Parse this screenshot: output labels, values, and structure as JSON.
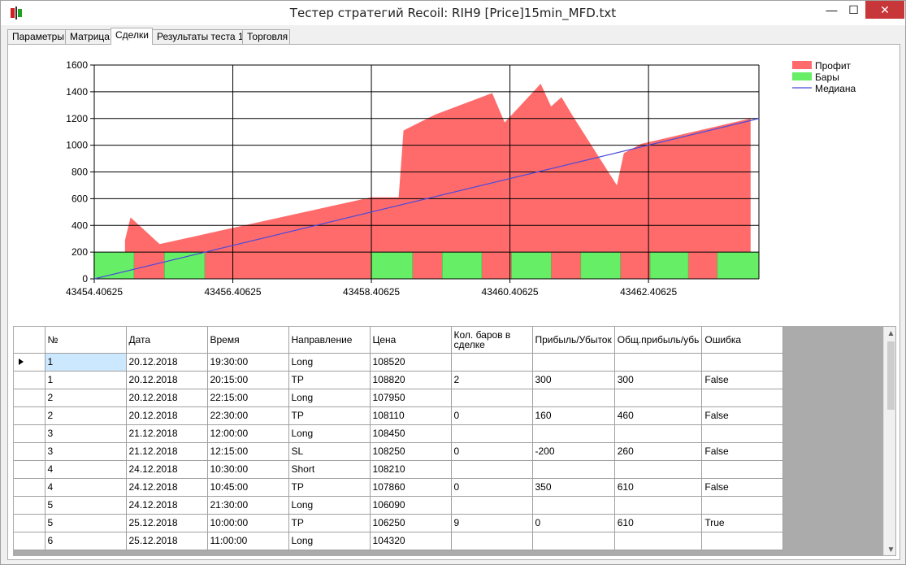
{
  "window": {
    "title": "Тестер стратегий Recoil: RIH9 [Price]15min_MFD.txt",
    "minimize": "—",
    "maximize": "☐",
    "close": "✕"
  },
  "tabs": [
    {
      "label": "Параметры"
    },
    {
      "label": "Матрица"
    },
    {
      "label": "Сделки",
      "active": true
    },
    {
      "label": "Результаты теста 1"
    },
    {
      "label": "Торговля"
    }
  ],
  "chart_data": {
    "type": "area",
    "x_ticks": [
      "43454.40625",
      "43456.40625",
      "43458.40625",
      "43460.40625",
      "43462.40625"
    ],
    "x_tick_values": [
      43454.40625,
      43456.40625,
      43458.40625,
      43460.40625,
      43462.40625
    ],
    "xlim": [
      43454.40625,
      43464.0
    ],
    "ylim": [
      0,
      1600
    ],
    "y_ticks": [
      0,
      200,
      400,
      600,
      800,
      1000,
      1200,
      1400,
      1600
    ],
    "grid": true,
    "legend_position": "top-right",
    "series": [
      {
        "name": "Профит",
        "type": "area",
        "color": "#ff6b6b",
        "x": [
          43454.85,
          43454.85,
          43454.93,
          43455.35,
          43458.4,
          43458.8,
          43458.87,
          43459.1,
          43459.33,
          43460.15,
          43460.33,
          43460.85,
          43461.0,
          43461.15,
          43461.3,
          43461.95,
          43462.05,
          43462.3,
          43463.88
        ],
        "y": [
          0,
          290,
          460,
          260,
          610,
          610,
          1110,
          1170,
          1230,
          1390,
          1170,
          1460,
          1290,
          1360,
          1230,
          700,
          940,
          1010,
          1200
        ]
      },
      {
        "name": "Бары",
        "type": "bars",
        "color": "#66ee66",
        "level": 200,
        "blocks": [
          [
            43454.4,
            43454.98
          ],
          [
            43455.42,
            43456.0
          ],
          [
            43458.4,
            43459.0
          ],
          [
            43459.43,
            43460.0
          ],
          [
            43460.43,
            43461.0
          ],
          [
            43461.43,
            43462.0
          ],
          [
            43462.43,
            43462.98
          ],
          [
            43463.4,
            43464.0
          ]
        ]
      },
      {
        "name": "Медиана",
        "type": "line",
        "color": "#4a4adb",
        "x": [
          43454.40625,
          43464.0
        ],
        "y": [
          0,
          1200
        ]
      }
    ]
  },
  "grid": {
    "columns": [
      "№",
      "Дата",
      "Время",
      "Направление",
      "Цена",
      "Кол. баров в сделке",
      "Прибыль/Убыток",
      "Общ.прибыль/убь",
      "Ошибка"
    ],
    "rows": [
      [
        "1",
        "20.12.2018",
        "19:30:00",
        "Long",
        "108520",
        "",
        "",
        "",
        ""
      ],
      [
        "1",
        "20.12.2018",
        "20:15:00",
        "TP",
        "108820",
        "2",
        "300",
        "300",
        "False"
      ],
      [
        "2",
        "20.12.2018",
        "22:15:00",
        "Long",
        "107950",
        "",
        "",
        "",
        ""
      ],
      [
        "2",
        "20.12.2018",
        "22:30:00",
        "TP",
        "108110",
        "0",
        "160",
        "460",
        "False"
      ],
      [
        "3",
        "21.12.2018",
        "12:00:00",
        "Long",
        "108450",
        "",
        "",
        "",
        ""
      ],
      [
        "3",
        "21.12.2018",
        "12:15:00",
        "SL",
        "108250",
        "0",
        "-200",
        "260",
        "False"
      ],
      [
        "4",
        "24.12.2018",
        "10:30:00",
        "Short",
        "108210",
        "",
        "",
        "",
        ""
      ],
      [
        "4",
        "24.12.2018",
        "10:45:00",
        "TP",
        "107860",
        "0",
        "350",
        "610",
        "False"
      ],
      [
        "5",
        "24.12.2018",
        "21:30:00",
        "Long",
        "106090",
        "",
        "",
        "",
        ""
      ],
      [
        "5",
        "25.12.2018",
        "10:00:00",
        "TP",
        "106250",
        "9",
        "0",
        "610",
        "True"
      ],
      [
        "6",
        "25.12.2018",
        "11:00:00",
        "Long",
        "104320",
        "",
        "",
        "",
        ""
      ]
    ],
    "selected_row": 0
  }
}
